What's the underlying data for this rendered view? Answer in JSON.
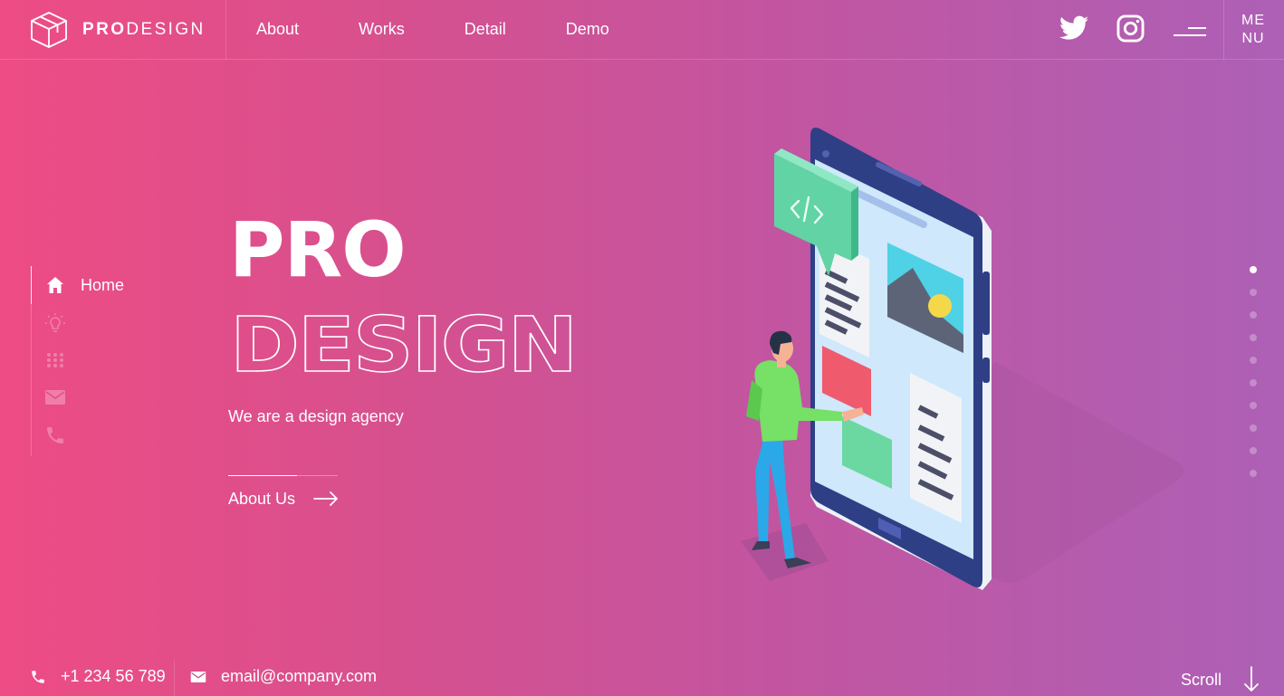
{
  "brand": {
    "bold": "PRO",
    "light": "DESIGN"
  },
  "nav": {
    "items": [
      "About",
      "Works",
      "Detail",
      "Demo"
    ]
  },
  "header": {
    "menu_label_top": "ME",
    "menu_label_bottom": "NU"
  },
  "side_nav": {
    "active_label": "Home"
  },
  "hero": {
    "title_solid": "PRO",
    "title_outline": "DESIGN",
    "tagline": "We are a design agency",
    "cta_label": "About Us"
  },
  "footer": {
    "phone": "+1 234 56 789",
    "email": "email@company.com",
    "scroll_label": "Scroll"
  },
  "colors": {
    "gradient_start": "#ee4c84",
    "gradient_end": "#ad60b6",
    "text": "#ffffff"
  },
  "icons": [
    "logo-cube-icon",
    "twitter-icon",
    "instagram-icon",
    "menu-lines-icon",
    "home-icon",
    "bulb-icon",
    "grid-icon",
    "mail-icon",
    "phone-icon",
    "arrow-right-icon",
    "arrow-down-icon"
  ]
}
